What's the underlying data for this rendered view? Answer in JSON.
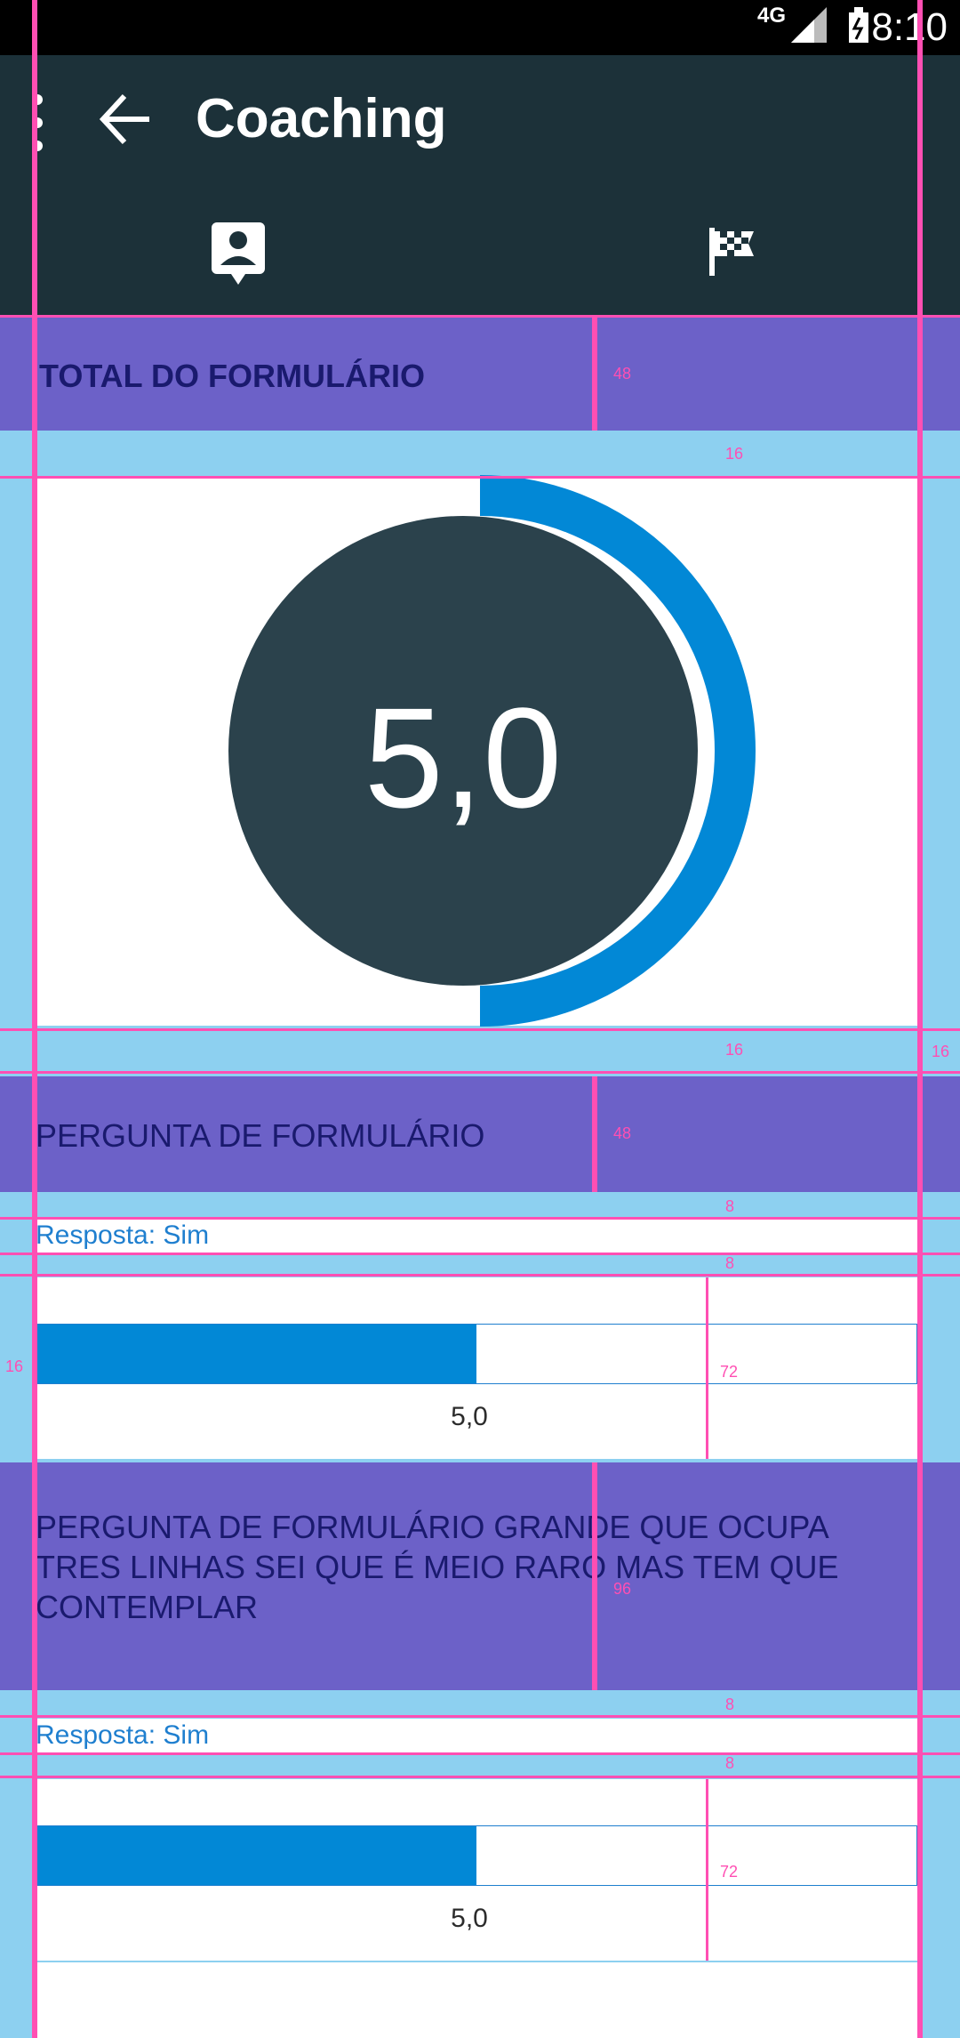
{
  "status_bar": {
    "network": "4G",
    "time": "8:10"
  },
  "app_bar": {
    "title": "Coaching",
    "tabs": [
      {
        "icon": "contact-icon"
      },
      {
        "icon": "checkered-flag-icon"
      }
    ]
  },
  "total": {
    "label": "TOTAL DO FORMULÁRIO",
    "score_text": "5,0",
    "score_fraction": 0.5
  },
  "questions": [
    {
      "title": "PERGUNTA DE FORMULÁRIO",
      "answer": "Resposta: Sim",
      "score_text": "5,0",
      "fill_fraction": 0.5
    },
    {
      "title": "PERGUNTA DE FORMULÁRIO GRANDE QUE OCUPA TRES LINHAS SEI QUE É MEIO RARO MAS TEM QUE CONTEMPLAR",
      "answer": "Resposta: Sim",
      "score_text": "5,0",
      "fill_fraction": 0.5
    }
  ],
  "guide_labels": [
    "48",
    "16",
    "16",
    "16",
    "48",
    "8",
    "8",
    "16",
    "72",
    "96",
    "8",
    "8",
    "72"
  ],
  "colors": {
    "accent": "#0288d6",
    "circle": "#2b424c",
    "overlay_blue": "#8dd0f0",
    "overlay_purple": "#6c61c8",
    "guide_pink": "#ff4fb3"
  }
}
